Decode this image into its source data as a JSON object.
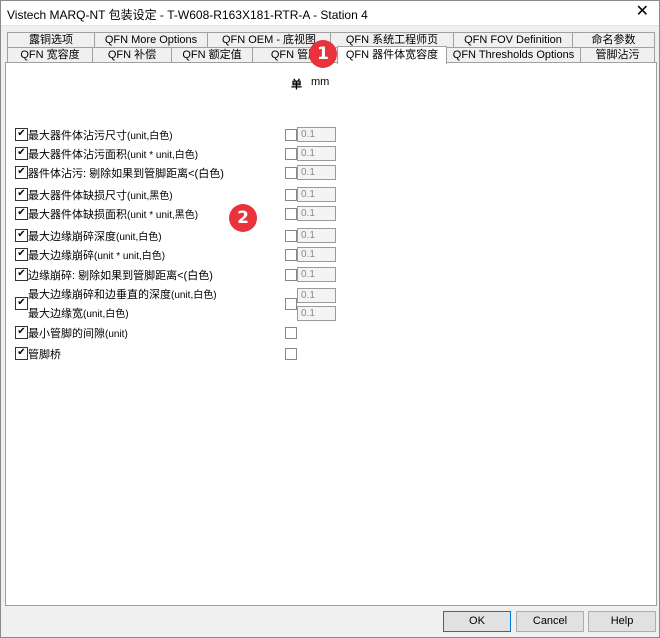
{
  "window": {
    "title": "Vistech MARQ-NT 包装设定 - T-W608-R163X181-RTR-A - Station 4",
    "close": "✕"
  },
  "tabs_row1": [
    "露铜选项",
    "QFN More Options",
    "QFN OEM - 底视图",
    "QFN 系统工程师页",
    "QFN FOV Definition",
    "命名参数"
  ],
  "tabs_row2": [
    "QFN 宽容度",
    "QFN 补偿",
    "QFN 额定值",
    "QFN 管脚",
    "QFN 器件体宽容度",
    "QFN Thresholds Options",
    "管脚沾污"
  ],
  "units": {
    "header": "单",
    "unit": "mm"
  },
  "rows": [
    {
      "label": "最大器件体沾污尺寸",
      "suffix": "(unit,白色)",
      "value": "0.1"
    },
    {
      "label": "最大器件体沾污面积",
      "suffix": "(unit * unit,白色)",
      "value": "0.1"
    },
    {
      "label": "器件体沾污: 剔除如果到管脚距离<(白色)",
      "suffix": "",
      "value": "0.1"
    },
    {
      "label": "最大器件体缺损尺寸",
      "suffix": "(unit,黑色)",
      "value": "0.1"
    },
    {
      "label": "最大器件体缺损面积",
      "suffix": "(unit * unit,黑色)",
      "value": "0.1"
    },
    {
      "label": "最大边缘崩碎深度",
      "suffix": "(unit,白色)",
      "value": "0.1"
    },
    {
      "label": "最大边缘崩碎",
      "suffix": "(unit * unit,白色)",
      "value": "0.1"
    },
    {
      "label": "边缘崩碎: 剔除如果到管脚距离<(白色)",
      "suffix": "",
      "value": "0.1"
    },
    {
      "label": "最大边缘崩碎和边垂直的深度",
      "suffix": "(unit,白色)",
      "label2": "最大边缘宽",
      "suffix2": "(unit,白色)",
      "value": "0.1",
      "value2": "0.1"
    },
    {
      "label": "最小管脚的间隙",
      "suffix": "(unit)"
    },
    {
      "label": "管脚桥",
      "suffix": ""
    }
  ],
  "checkmark": "✔",
  "badges": [
    "1",
    "2"
  ],
  "buttons": {
    "ok": "OK",
    "cancel": "Cancel",
    "help": "Help"
  }
}
